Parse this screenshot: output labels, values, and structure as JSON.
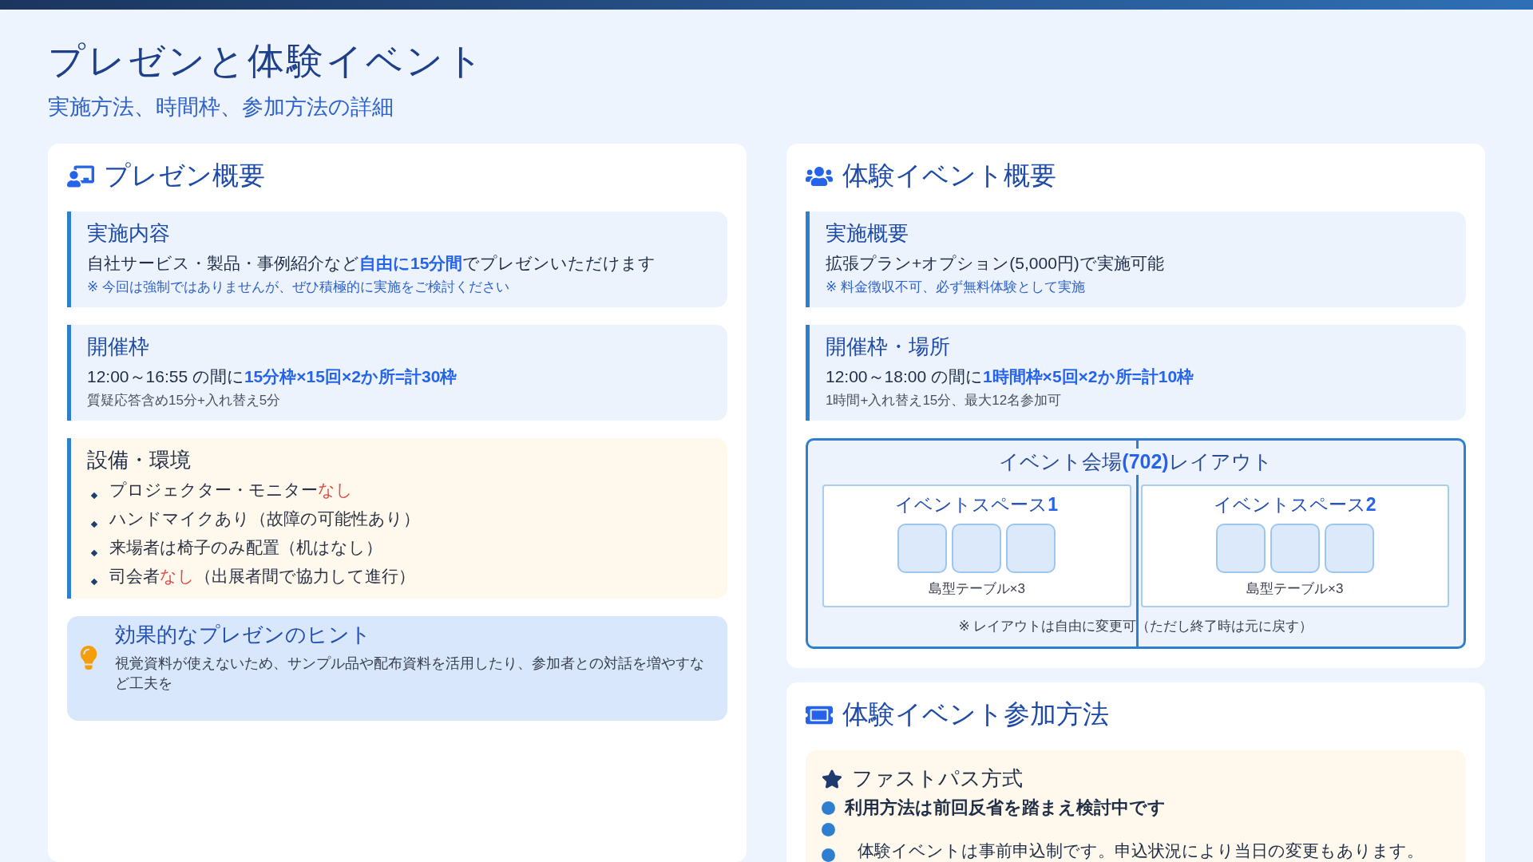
{
  "header": {
    "title": "プレゼンと体験イベント",
    "subtitle": "実施方法、時間枠、参加方法の詳細"
  },
  "presentation": {
    "heading": "プレゼン概要",
    "blocks": [
      {
        "kind": "info",
        "title": "実施内容",
        "lines": [
          {
            "kind": "main",
            "text": "自社サービス・製品・事例紹介など**自由に15分間**でプレゼンいただけます"
          },
          {
            "kind": "note",
            "text": "※ 今回は強制ではありませんが、ぜひ積極的に実施をご検討ください"
          }
        ]
      },
      {
        "kind": "info",
        "title": "開催枠",
        "lines": [
          {
            "kind": "main",
            "text": "12:00～16:55 の間に**15分枠×15回×2か所=計30枠**"
          },
          {
            "kind": "sub",
            "text": "質疑応答含め15分+入れ替え5分"
          }
        ]
      },
      {
        "kind": "warning",
        "title": "設備・環境",
        "bullets": [
          [
            {
              "kind": "plain",
              "text": "プロジェクター・モニター"
            },
            {
              "kind": "alert",
              "text": "なし"
            }
          ],
          [
            {
              "kind": "plain",
              "text": "ハンドマイクあり（故障の可能性あり）"
            }
          ],
          [
            {
              "kind": "plain",
              "text": "来場者は椅子のみ配置（机はなし）"
            }
          ],
          [
            {
              "kind": "plain",
              "text": "司会者"
            },
            {
              "kind": "alert",
              "text": "なし"
            },
            {
              "kind": "plain",
              "text": "（出展者間で協力して進行）"
            }
          ]
        ]
      }
    ],
    "hint": {
      "title": "効果的なプレゼンのヒント",
      "text": "視覚資料が使えないため、サンプル品や配布資料を活用したり、参加者との対話を増やすなど工夫を"
    }
  },
  "event": {
    "heading": "体験イベント概要",
    "blocks": [
      {
        "kind": "info",
        "title": "実施概要",
        "lines": [
          {
            "kind": "main",
            "text": "拡張プラン+オプション(5,000円)で実施可能"
          },
          {
            "kind": "note",
            "text": "※ 料金徴収不可、必ず無料体験として実施"
          }
        ]
      },
      {
        "kind": "info",
        "title": "開催枠・場所",
        "lines": [
          {
            "kind": "main",
            "text": "12:00～18:00 の間に**1時間枠×5回×2か所=計10枠**"
          },
          {
            "kind": "sub",
            "text": "1時間+入れ替え15分、最大12名参加可"
          }
        ]
      }
    ],
    "venue": {
      "title": "イベント会場**(702)**レイアウト",
      "spaces": [
        {
          "name": "イベントスペース**1**",
          "caption": "島型テーブル×3"
        },
        {
          "name": "イベントスペース**2**",
          "caption": "島型テーブル×3"
        }
      ],
      "note": "※ レイアウトは自由に変更可（ただし終了時は元に戻す）"
    }
  },
  "participation": {
    "heading": "体験イベント参加方法",
    "method": {
      "title": "ファストパス方式",
      "items": [
        {
          "kind": "lead",
          "text": "利用方法は前回反省を踏まえ検討中です"
        },
        {
          "kind": "blank"
        },
        {
          "kind": "text",
          "text": "体験イベントは事前申込制です。申込状況により当日の変更もあります。"
        }
      ]
    }
  }
}
